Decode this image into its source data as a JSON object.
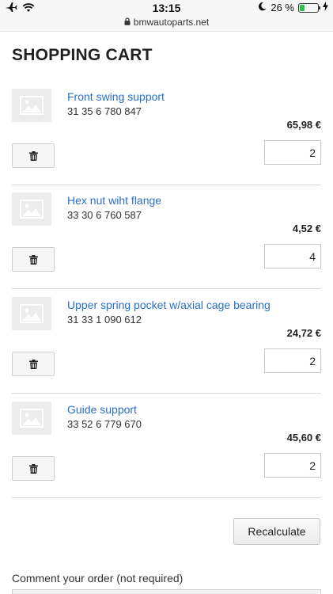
{
  "status_bar": {
    "time": "13:15",
    "battery_percent_label": "26 %",
    "battery_level": 0.26,
    "url": "bmwautoparts.net",
    "icons": [
      "airplane-icon",
      "wifi-icon",
      "moon-icon",
      "battery-icon",
      "charging-icon",
      "lock-icon"
    ]
  },
  "page": {
    "title": "SHOPPING CART"
  },
  "cart": {
    "items": [
      {
        "name": "Front swing support",
        "code": "31 35 6 780 847",
        "price": "65,98 €",
        "quantity": "2"
      },
      {
        "name": "Hex nut wiht flange",
        "code": "33 30 6 760 587",
        "price": "4,52 €",
        "quantity": "4"
      },
      {
        "name": "Upper spring pocket w/axial cage bearing",
        "code": "31 33 1 090 612",
        "price": "24,72 €",
        "quantity": "2"
      },
      {
        "name": "Guide support",
        "code": "33 52 6 779 670",
        "price": "45,60 €",
        "quantity": "2"
      }
    ],
    "recalculate_label": "Recalculate"
  },
  "comment": {
    "label": "Comment your order (not required)"
  },
  "colors": {
    "link": "#2a6fc9",
    "battery": "#2fbf4a"
  }
}
